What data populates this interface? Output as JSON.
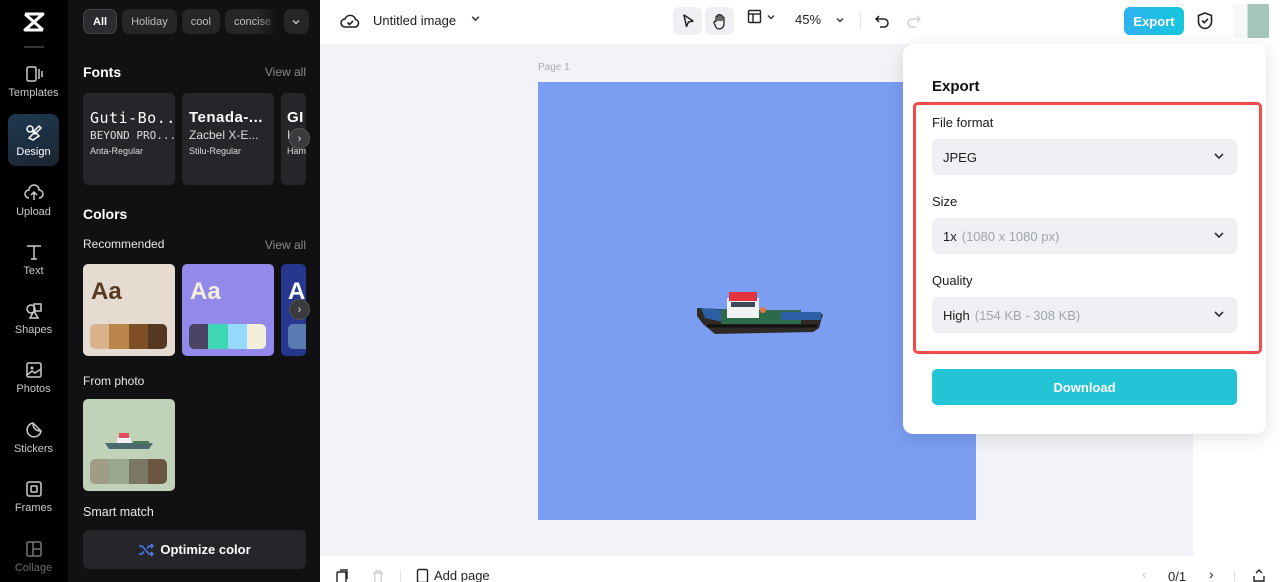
{
  "rail": {
    "items": [
      {
        "label": "Templates",
        "icon": "templates-icon"
      },
      {
        "label": "Design",
        "icon": "design-icon",
        "active": true
      },
      {
        "label": "Upload",
        "icon": "upload-icon"
      },
      {
        "label": "Text",
        "icon": "text-icon"
      },
      {
        "label": "Shapes",
        "icon": "shapes-icon"
      },
      {
        "label": "Photos",
        "icon": "photos-icon"
      },
      {
        "label": "Stickers",
        "icon": "stickers-icon"
      },
      {
        "label": "Frames",
        "icon": "frames-icon"
      },
      {
        "label": "Collage",
        "icon": "collage-icon"
      }
    ]
  },
  "panel": {
    "chips": [
      "All",
      "Holiday",
      "cool",
      "concise"
    ],
    "fonts": {
      "title": "Fonts",
      "view_all": "View all",
      "cards": [
        {
          "line1": "Guti-Bo...",
          "line2": "BEYOND PRO...",
          "line3": "Anta-Regular"
        },
        {
          "line1": "Tenada-...",
          "line2": "Zacbel X-E...",
          "line3": "Stilu-Regular"
        },
        {
          "line1": "GI",
          "line2": "I",
          "line3": "Ham"
        }
      ]
    },
    "colors": {
      "title": "Colors",
      "recommended": "Recommended",
      "view_all": "View all",
      "sample_text": "Aa",
      "palettes": [
        {
          "bg": "#e6dbd0",
          "text": "#5a3a22",
          "swatches": [
            "#d8b38c",
            "#b98549",
            "#7e4f27",
            "#56371f"
          ]
        },
        {
          "bg": "#9289ea",
          "text": "#f4eedd",
          "swatches": [
            "#4a4566",
            "#3fd6b3",
            "#95d9fb",
            "#f3efdc"
          ]
        },
        {
          "bg": "#26378d",
          "text": "#ffffff",
          "swatches": [
            "#5a7ab2"
          ]
        }
      ],
      "from_photo": "From photo",
      "photo_swatches": [
        "#a19c85",
        "#98a88f",
        "#7c7762",
        "#6a5540"
      ],
      "smart_match": "Smart match",
      "optimize": "Optimize color"
    }
  },
  "topbar": {
    "doc_title": "Untitled image",
    "zoom": "45%",
    "export": "Export"
  },
  "canvas": {
    "page_label": "Page 1",
    "page_color": "#7b9ef2"
  },
  "bottombar": {
    "add_page": "Add page",
    "pager": "0/1"
  },
  "export_popover": {
    "title": "Export",
    "file_format_label": "File format",
    "file_format_value": "JPEG",
    "size_label": "Size",
    "size_value": "1x",
    "size_detail": "(1080 x 1080 px)",
    "quality_label": "Quality",
    "quality_value": "High",
    "quality_detail": "(154 KB - 308 KB)",
    "download": "Download"
  }
}
